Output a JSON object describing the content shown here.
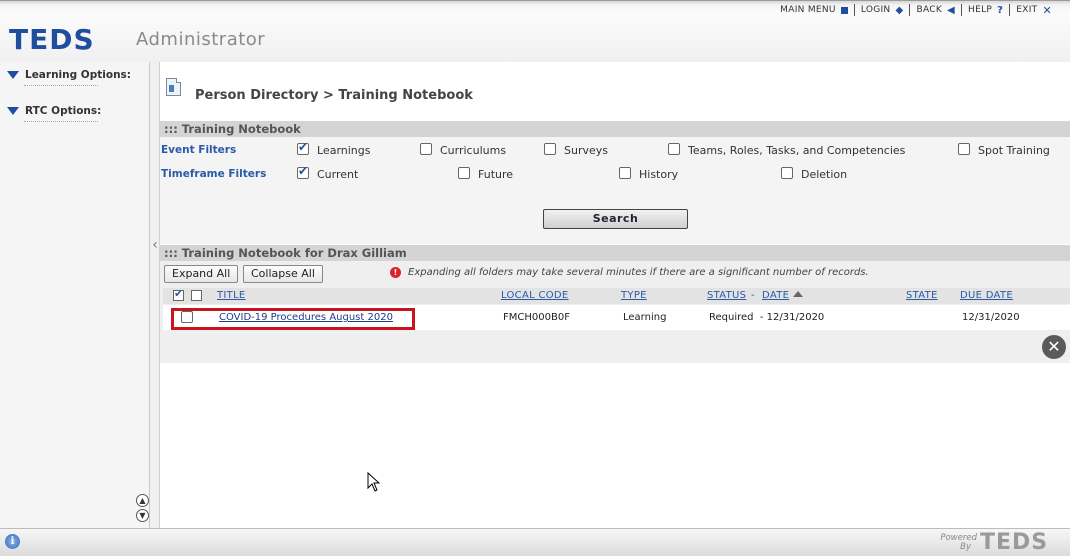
{
  "topmenu": {
    "main_menu": "MAIN MENU",
    "login": "LOGIN",
    "back": "BACK",
    "help": "HELP",
    "exit": "EXIT"
  },
  "brand": {
    "logo_text": "TEDS",
    "app_name": "Administrator",
    "accent": "#1f4e9c"
  },
  "sidebar": {
    "items": [
      {
        "label": "Learning Options:"
      },
      {
        "label": "RTC Options:"
      }
    ]
  },
  "page": {
    "breadcrumb": "Person Directory > Training Notebook"
  },
  "filters": {
    "section_title": "::: Training Notebook",
    "event_label": "Event Filters",
    "timeframe_label": "Timeframe Filters",
    "event_options": [
      {
        "label": "Learnings",
        "checked": true
      },
      {
        "label": "Curriculums",
        "checked": false
      },
      {
        "label": "Surveys",
        "checked": false
      },
      {
        "label": "Teams, Roles, Tasks, and Competencies",
        "checked": false
      },
      {
        "label": "Spot Training",
        "checked": false
      }
    ],
    "timeframe_options": [
      {
        "label": "Current",
        "checked": true
      },
      {
        "label": "Future",
        "checked": false
      },
      {
        "label": "History",
        "checked": false
      },
      {
        "label": "Deletion",
        "checked": false
      }
    ],
    "search_label": "Search"
  },
  "results": {
    "section_title": "::: Training Notebook for Drax Gilliam",
    "expand_all": "Expand All",
    "collapse_all": "Collapse All",
    "warning": "Expanding all folders may take several minutes if there are a significant number of records.",
    "columns": {
      "title": "TITLE",
      "local_code": "LOCAL CODE",
      "type": "TYPE",
      "status": "STATUS",
      "status_sep": "-",
      "date": "DATE",
      "state": "STATE",
      "due_date": "DUE DATE"
    },
    "rows": [
      {
        "title": "COVID-19 Procedures August 2020",
        "local_code": "FMCH000B0F",
        "type": "Learning",
        "status_date": "Required  - 12/31/2020",
        "state": "",
        "due_date": "12/31/2020"
      }
    ]
  },
  "footer": {
    "powered": "Powered",
    "by": "By",
    "logo_text": "TEDS"
  }
}
